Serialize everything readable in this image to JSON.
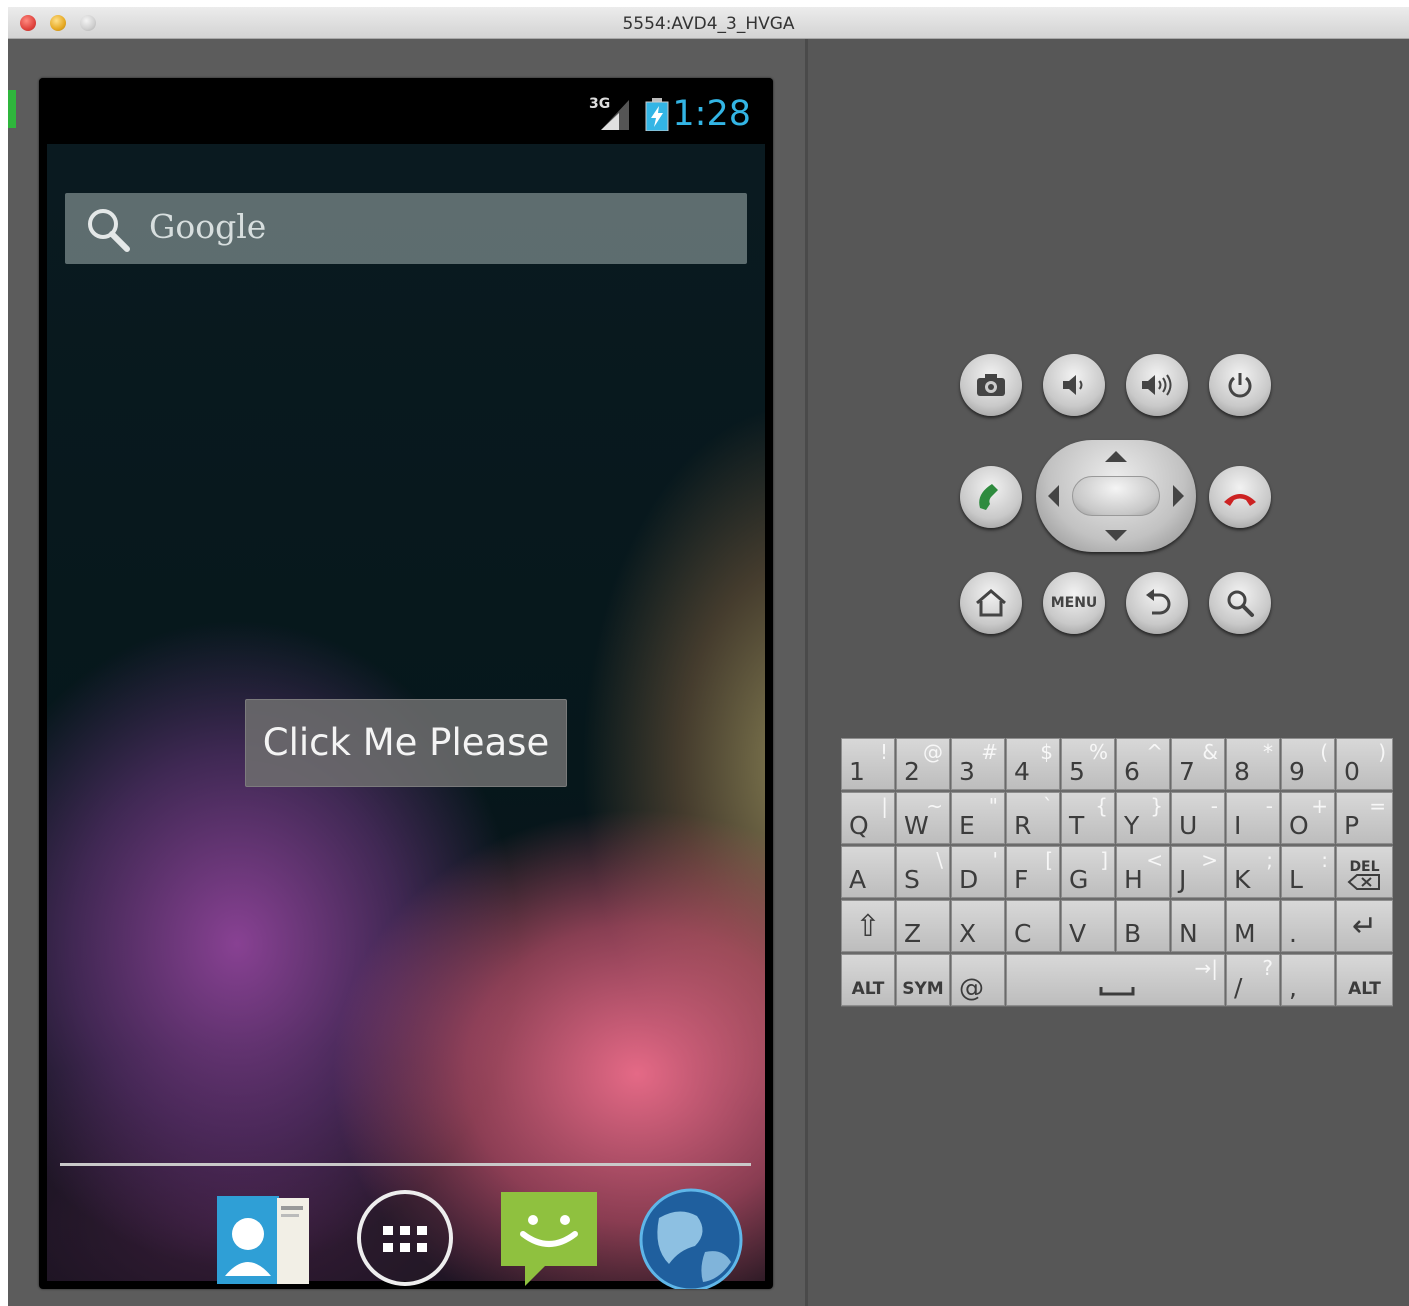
{
  "window": {
    "title": "5554:AVD4_3_HVGA"
  },
  "statusbar": {
    "network": "3G",
    "time": "1:28"
  },
  "search": {
    "label": "Google"
  },
  "button": {
    "label": "Click Me Please"
  },
  "dock": {
    "items": [
      {
        "name": "contacts-icon"
      },
      {
        "name": "all-apps-icon"
      },
      {
        "name": "messaging-icon"
      },
      {
        "name": "browser-icon"
      }
    ]
  },
  "hardware": {
    "menu_label": "MENU"
  },
  "keyboard": {
    "rows": [
      [
        {
          "m": "1",
          "a": "!"
        },
        {
          "m": "2",
          "a": "@"
        },
        {
          "m": "3",
          "a": "#"
        },
        {
          "m": "4",
          "a": "$"
        },
        {
          "m": "5",
          "a": "%"
        },
        {
          "m": "6",
          "a": "^"
        },
        {
          "m": "7",
          "a": "&"
        },
        {
          "m": "8",
          "a": "*"
        },
        {
          "m": "9",
          "a": "("
        },
        {
          "m": "0",
          "a": ")"
        }
      ],
      [
        {
          "m": "Q",
          "a": "|"
        },
        {
          "m": "W",
          "a": "~"
        },
        {
          "m": "E",
          "a": "\""
        },
        {
          "m": "R",
          "a": "`"
        },
        {
          "m": "T",
          "a": "{"
        },
        {
          "m": "Y",
          "a": "}"
        },
        {
          "m": "U",
          "a": "-"
        },
        {
          "m": "I",
          "a": "-"
        },
        {
          "m": "O",
          "a": "+"
        },
        {
          "m": "P",
          "a": "="
        }
      ],
      [
        {
          "m": "A",
          "a": ""
        },
        {
          "m": "S",
          "a": "\\"
        },
        {
          "m": "D",
          "a": "'"
        },
        {
          "m": "F",
          "a": "["
        },
        {
          "m": "G",
          "a": "]"
        },
        {
          "m": "H",
          "a": "<"
        },
        {
          "m": "J",
          "a": ">"
        },
        {
          "m": "K",
          "a": ";"
        },
        {
          "m": "L",
          "a": ":"
        },
        {
          "m": "DEL",
          "a": ""
        }
      ],
      [
        {
          "m": "⇧",
          "a": ""
        },
        {
          "m": "Z",
          "a": ""
        },
        {
          "m": "X",
          "a": ""
        },
        {
          "m": "C",
          "a": ""
        },
        {
          "m": "V",
          "a": ""
        },
        {
          "m": "B",
          "a": ""
        },
        {
          "m": "N",
          "a": ""
        },
        {
          "m": "M",
          "a": ""
        },
        {
          "m": ".",
          "a": ""
        },
        {
          "m": "↵",
          "a": ""
        }
      ]
    ],
    "bottom": {
      "alt_left": "ALT",
      "sym": "SYM",
      "at": "@",
      "space_tab": "→|",
      "slash": "/",
      "question": "?",
      "comma": ",",
      "alt_right": "ALT"
    }
  }
}
